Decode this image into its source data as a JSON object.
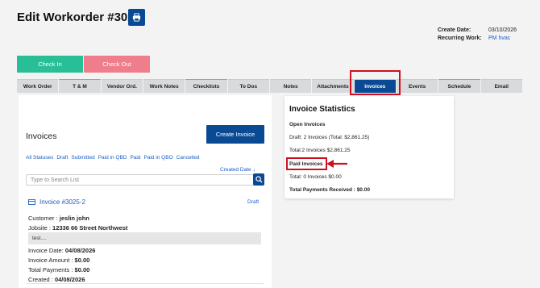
{
  "header": {
    "title": "Edit Workorder #3025",
    "create_date_label": "Create Date:",
    "create_date": "03/10/2026",
    "recurring_label": "Recurring Work:",
    "recurring_value": "PM hvac"
  },
  "actions": {
    "check_in": "Check In",
    "check_out": "Check Out"
  },
  "tabs": [
    "Work Order",
    "T & M",
    "Vendor Ord.",
    "Work Notes",
    "Checklists",
    "To Dos",
    "Notes",
    "Attachments",
    "Invoices",
    "Events",
    "Schedule",
    "Email"
  ],
  "active_tab": "Invoices",
  "invoices_panel": {
    "title": "Invoices",
    "create_button": "Create Invoice",
    "filters": [
      "All Statuses",
      "Draft",
      "Submitted",
      "Paid in QBD",
      "Paid",
      "Paid in QBO",
      "Cancelled"
    ],
    "sort_label": "Created Date ↓",
    "search_placeholder": "Type to Search List",
    "invoice": {
      "number": "Invoice #3025-2",
      "status": "Draft",
      "customer_label": "Customer :",
      "customer": "jeslin john",
      "jobsite_label": "Jobsite :",
      "jobsite": "12336 66 Street Northwest",
      "note": "test....",
      "invoice_date_label": "Invoice Date:",
      "invoice_date": "04/08/2026",
      "invoice_amount_label": "Invoice Amount :",
      "invoice_amount": "$0.00",
      "total_payments_label": "Total Payments :",
      "total_payments": "$0.00",
      "created_label": "Created :",
      "created": "04/08/2026"
    }
  },
  "stats": {
    "title": "Invoice Statistics",
    "open_heading": "Open Invoices",
    "draft_line": "Draft: 2 Invoices (Total: $2,861.25)",
    "open_total": "Total:2 Invoices $2,861.25",
    "paid_heading": "Paid Invoices",
    "paid_total": "Total: 0 Invoices $0.00",
    "payments_received": "Total Payments Received : $0.00"
  },
  "colors": {
    "primary": "#0a4a94",
    "check_in": "#29bf96",
    "check_out": "#ef7d8b",
    "link": "#1a5fc7",
    "highlight": "#d01020"
  }
}
